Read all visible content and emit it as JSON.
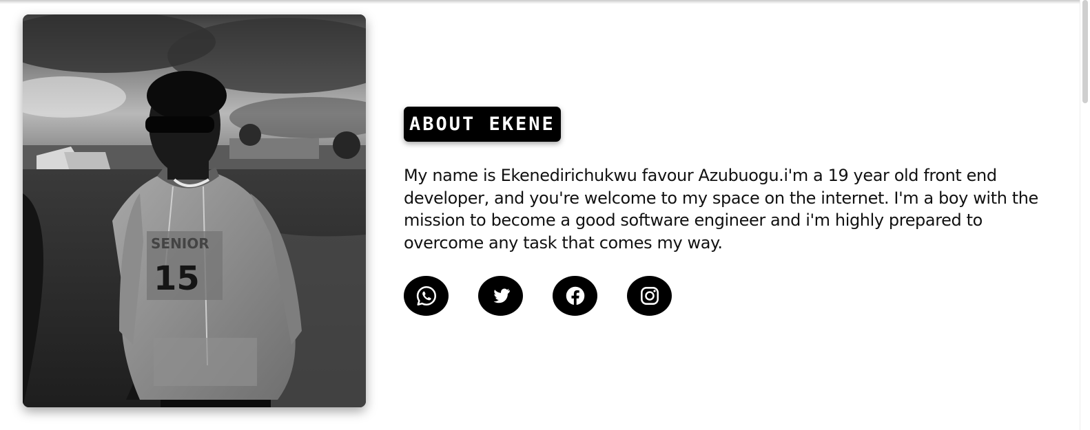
{
  "about": {
    "heading": "About Ekene",
    "bio": "My name is Ekenedirichukwu favour Azubuogu.i'm a 19 year old front end developer, and you're welcome to my space on the internet. I'm a boy with the mission to become a good software engineer and i'm highly prepared to overcome any task that comes my way."
  },
  "photo": {
    "icon": "portrait-photo",
    "hoodie_number": "15",
    "hoodie_text": "SENIOR"
  },
  "social": [
    {
      "name": "whatsapp",
      "icon": "whatsapp-icon"
    },
    {
      "name": "twitter",
      "icon": "twitter-icon"
    },
    {
      "name": "facebook",
      "icon": "facebook-icon"
    },
    {
      "name": "instagram",
      "icon": "instagram-icon"
    }
  ],
  "colors": {
    "background": "#ffffff",
    "heading_bg": "#000000",
    "heading_text": "#ffffff",
    "social_bg": "#000000",
    "social_icon": "#ffffff",
    "body_text": "#111111"
  }
}
